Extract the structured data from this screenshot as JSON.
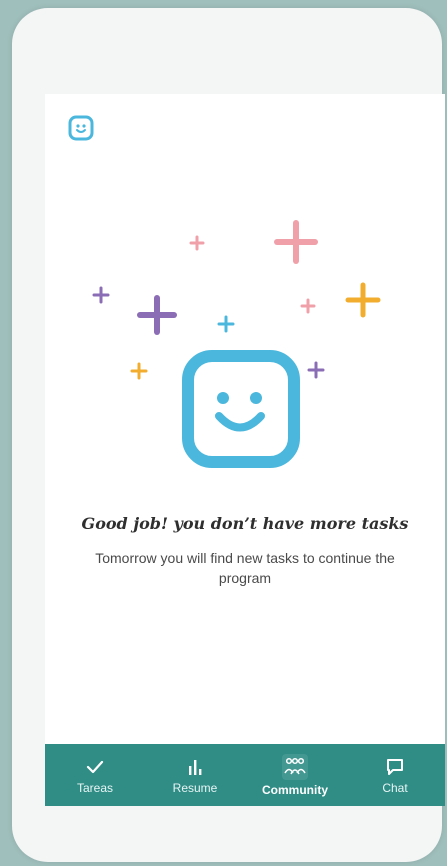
{
  "colors": {
    "background": "#9fbfbc",
    "nav_bar": "#2f8d86",
    "brand_blue": "#4bb7dd",
    "plus_pink": "#f0a0a8",
    "plus_purple": "#8a6db5",
    "plus_orange": "#f2ad2e",
    "plus_blue": "#4bb7dd"
  },
  "header": {
    "logo_icon": "smiley-face-icon"
  },
  "empty_state": {
    "illustration_icon": "smiling-face-with-confetti",
    "title": "Good job! you don’t have more tasks",
    "message": "Tomorrow you will find new tasks to continue the program"
  },
  "nav": {
    "items": [
      {
        "label": "Tareas",
        "icon": "check-icon"
      },
      {
        "label": "Resume",
        "icon": "bar-chart-icon"
      },
      {
        "label": "Community",
        "icon": "community-icon",
        "active": true
      },
      {
        "label": "Chat",
        "icon": "chat-bubble-icon"
      }
    ]
  }
}
